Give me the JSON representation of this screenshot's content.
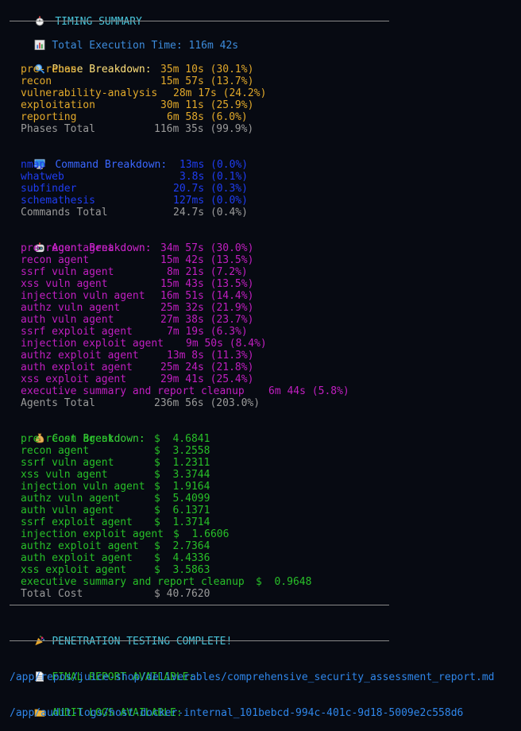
{
  "timing": {
    "header": "TIMING SUMMARY",
    "total": "Total Execution Time: 116m 42s",
    "phase_title": "Phase Breakdown:",
    "phases": [
      {
        "name": "pre-recon",
        "value": "35m 10s (30.1%)"
      },
      {
        "name": "recon",
        "value": "15m 57s (13.7%)"
      },
      {
        "name": "vulnerability-analysis",
        "value": "28m 17s (24.2%)"
      },
      {
        "name": "exploitation",
        "value": "30m 11s (25.9%)"
      },
      {
        "name": "reporting",
        "value": "6m 58s (6.0%)"
      }
    ],
    "phases_total": {
      "name": "Phases Total",
      "value": "116m 35s (99.9%)"
    },
    "command_title": "Command Breakdown:",
    "commands": [
      {
        "name": "nmap",
        "value": "13ms (0.0%)"
      },
      {
        "name": "whatweb",
        "value": "3.8s (0.1%)"
      },
      {
        "name": "subfinder",
        "value": "20.7s (0.3%)"
      },
      {
        "name": "schemathesis",
        "value": "127ms (0.0%)"
      }
    ],
    "commands_total": {
      "name": "Commands Total",
      "value": "24.7s (0.4%)"
    },
    "agent_title": "Agent Breakdown:",
    "agents": [
      {
        "name": "pre recon agent",
        "value": "34m 57s (30.0%)"
      },
      {
        "name": "recon agent",
        "value": "15m 42s (13.5%)"
      },
      {
        "name": "ssrf vuln agent",
        "value": "8m 21s (7.2%)"
      },
      {
        "name": "xss vuln agent",
        "value": "15m 43s (13.5%)"
      },
      {
        "name": "injection vuln agent",
        "value": "16m 51s (14.4%)"
      },
      {
        "name": "authz vuln agent",
        "value": "25m 32s (21.9%)"
      },
      {
        "name": "auth vuln agent",
        "value": "27m 38s (23.7%)"
      },
      {
        "name": "ssrf exploit agent",
        "value": "7m 19s (6.3%)"
      },
      {
        "name": "injection exploit agent",
        "value": "9m 50s (8.4%)"
      },
      {
        "name": "authz exploit agent",
        "value": "13m 8s (11.3%)"
      },
      {
        "name": "auth exploit agent",
        "value": "25m 24s (21.8%)"
      },
      {
        "name": "xss exploit agent",
        "value": "29m 41s (25.4%)"
      },
      {
        "name": "executive summary and report cleanup",
        "value": "6m 44s (5.8%)"
      }
    ],
    "agents_total": {
      "name": "Agents Total",
      "value": "236m 56s (203.0%)"
    },
    "cost_title": "Cost Breakdown:",
    "costs": [
      {
        "name": "pre recon agent",
        "value": "$  4.6841"
      },
      {
        "name": "recon agent",
        "value": "$  3.2558"
      },
      {
        "name": "ssrf vuln agent",
        "value": "$  1.2311"
      },
      {
        "name": "xss vuln agent",
        "value": "$  3.3744"
      },
      {
        "name": "injection vuln agent",
        "value": "$  1.9164"
      },
      {
        "name": "authz vuln agent",
        "value": "$  5.4099"
      },
      {
        "name": "auth vuln agent",
        "value": "$  6.1371"
      },
      {
        "name": "ssrf exploit agent",
        "value": "$  1.3714"
      },
      {
        "name": "injection exploit agent",
        "value": "$  1.6606"
      },
      {
        "name": "authz exploit agent",
        "value": "$  2.7364"
      },
      {
        "name": "auth exploit agent",
        "value": "$  4.4336"
      },
      {
        "name": "xss exploit agent",
        "value": "$  3.5863"
      },
      {
        "name": "executive summary and report cleanup",
        "value": "$  0.9648"
      }
    ],
    "cost_total": {
      "name": "Total Cost",
      "value": "$ 40.7620"
    }
  },
  "complete": "PENETRATION TESTING COMPLETE!",
  "report": {
    "label": "FINAL REPORT AVAILABLE:",
    "path": "/app/repos/juice-shop/deliverables/comprehensive_security_assessment_report.md"
  },
  "audit": {
    "label": "AUDIT LOGS AVAILABLE:",
    "path": "/app/audit-logs/host-docker-internal_101bebcd-994c-401c-9d18-5009e2c558d6"
  },
  "icons": {
    "header": "stopwatch-icon",
    "total": "bar-chart-icon",
    "phase": "magnifier-icon",
    "command": "monitor-icon",
    "agent": "robot-icon",
    "cost": "money-bag-icon",
    "complete": "party-popper-icon",
    "report": "document-icon",
    "audit": "folder-icon"
  },
  "colors": {
    "background": "#070a12",
    "header": "#49c4d9",
    "total": "#3d8cdc",
    "phase_title": "#ffe07a",
    "phase_rows": "#e2a92a",
    "command_rows": "#1f3df2",
    "agent_rows": "#c11fc1",
    "cost_rows": "#28c028",
    "totals": "#9a9a9a",
    "links": "#2f86ea"
  }
}
